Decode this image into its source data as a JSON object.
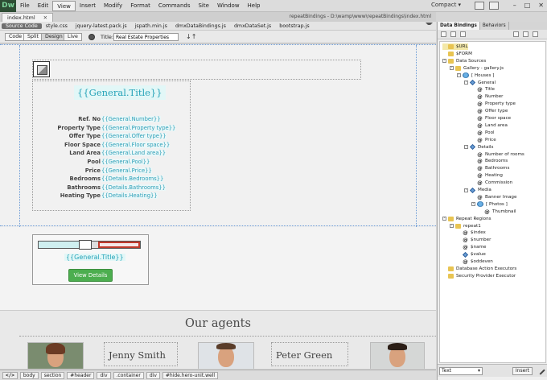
{
  "app": {
    "logo": "Dw",
    "menus": [
      "File",
      "Edit",
      "View",
      "Insert",
      "Modify",
      "Format",
      "Commands",
      "Site",
      "Window",
      "Help"
    ],
    "active_menu": "View",
    "workspace": "Compact"
  },
  "document": {
    "tab": "index.html",
    "path": "repeatBindings - D:\\wamp\\www\\repeatBindings\\index.html",
    "related_files": [
      "Source Code",
      "style.css",
      "jquery-latest.pack.js",
      "jspath.min.js",
      "dmxDataBindings.js",
      "dmxDataSet.js",
      "bootstrap.js"
    ]
  },
  "view_toolbar": {
    "buttons": [
      "Code",
      "Split",
      "Design",
      "Live"
    ],
    "active": "Design",
    "title_label": "Title:",
    "title_value": "Real Estate Properties"
  },
  "design": {
    "general_title": "{{General.Title}}",
    "properties": [
      {
        "label": "Ref. No",
        "value": "{{General.Number}}"
      },
      {
        "label": "Property Type",
        "value": "{{General.Property type}}"
      },
      {
        "label": "Offer Type",
        "value": "{{General.Offer type}}"
      },
      {
        "label": "Floor Space",
        "value": "{{General.Floor space}}"
      },
      {
        "label": "Land Area",
        "value": "{{General.Land area}}"
      },
      {
        "label": "Pool",
        "value": "{{General.Pool}}"
      },
      {
        "label": "Price",
        "value": "{{General.Price}}"
      },
      {
        "label": "Bedrooms",
        "value": "{{Details.Bedrooms}}"
      },
      {
        "label": "Bathrooms",
        "value": "{{Details.Bathrooms}}"
      },
      {
        "label": "Heating Type",
        "value": "{{Details.Heating}}"
      }
    ],
    "card_title": "{{General.Title}}",
    "view_details": "View Details",
    "agents_heading": "Our agents",
    "agents": [
      {
        "name": "Jenny Smith"
      },
      {
        "name": "Peter Green"
      }
    ]
  },
  "panel": {
    "tabs": [
      "Data Bindings",
      "Behaviors"
    ],
    "active_tab": "Data Bindings",
    "tree": [
      {
        "label": "$URL",
        "icon": "folder",
        "level": 0,
        "sel": true
      },
      {
        "label": "$FORM",
        "icon": "folder",
        "level": 0
      },
      {
        "label": "Data Sources",
        "icon": "folder",
        "level": 0,
        "toggle": "-"
      },
      {
        "label": "Gallery - gallery.js",
        "icon": "folder",
        "level": 1,
        "toggle": "-"
      },
      {
        "label": "[ Houses ]",
        "icon": "db",
        "level": 2,
        "toggle": "-"
      },
      {
        "label": "General",
        "icon": "diamond",
        "level": 3,
        "toggle": "-"
      },
      {
        "label": "Title",
        "icon": "at",
        "level": 4
      },
      {
        "label": "Number",
        "icon": "at",
        "level": 4
      },
      {
        "label": "Property type",
        "icon": "at",
        "level": 4
      },
      {
        "label": "Offer type",
        "icon": "at",
        "level": 4
      },
      {
        "label": "Floor space",
        "icon": "at",
        "level": 4
      },
      {
        "label": "Land area",
        "icon": "at",
        "level": 4
      },
      {
        "label": "Pool",
        "icon": "at",
        "level": 4
      },
      {
        "label": "Price",
        "icon": "at",
        "level": 4
      },
      {
        "label": "Details",
        "icon": "diamond",
        "level": 3,
        "toggle": "-"
      },
      {
        "label": "Number of rooms",
        "icon": "at",
        "level": 4
      },
      {
        "label": "Bedrooms",
        "icon": "at",
        "level": 4
      },
      {
        "label": "Bathrooms",
        "icon": "at",
        "level": 4
      },
      {
        "label": "Heating",
        "icon": "at",
        "level": 4
      },
      {
        "label": "Commission",
        "icon": "at",
        "level": 4
      },
      {
        "label": "Media",
        "icon": "diamond",
        "level": 3,
        "toggle": "-"
      },
      {
        "label": "Banner Image",
        "icon": "at",
        "level": 4
      },
      {
        "label": "[ Photos ]",
        "icon": "db",
        "level": 4,
        "toggle": "-"
      },
      {
        "label": "Thumbnail",
        "icon": "at",
        "level": 5
      },
      {
        "label": "Repeat Regions",
        "icon": "folder",
        "level": 0,
        "toggle": "-"
      },
      {
        "label": "repeat1",
        "icon": "folder",
        "level": 1,
        "toggle": "-"
      },
      {
        "label": "$index",
        "icon": "at",
        "level": 2
      },
      {
        "label": "$number",
        "icon": "at",
        "level": 2
      },
      {
        "label": "$name",
        "icon": "at",
        "level": 2
      },
      {
        "label": "$value",
        "icon": "diamond",
        "level": 2
      },
      {
        "label": "$oddeven",
        "icon": "at",
        "level": 2
      },
      {
        "label": "Database Action Executors",
        "icon": "folder",
        "level": 0
      },
      {
        "label": "Security Provider Executor",
        "icon": "folder",
        "level": 0
      }
    ],
    "insert_type": "Text",
    "insert_button": "Insert"
  },
  "statusbar": {
    "crumbs": [
      "</>",
      "body",
      "section",
      "#header",
      "div",
      ".container",
      "div",
      "#hide.hero-unit.well"
    ]
  }
}
